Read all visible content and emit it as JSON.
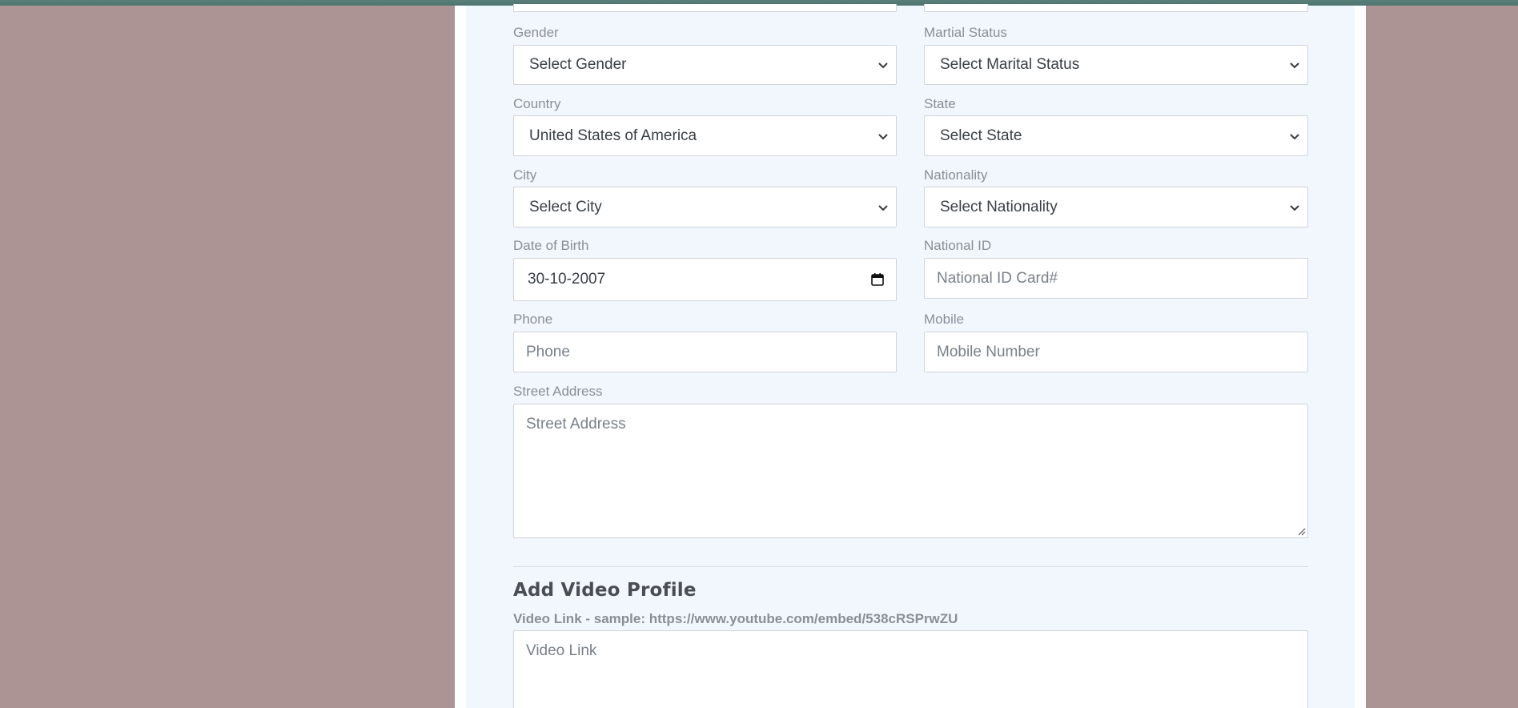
{
  "form": {
    "gender": {
      "label": "Gender",
      "value": "Select Gender"
    },
    "marital_status": {
      "label": "Martial Status",
      "value": "Select Marital Status"
    },
    "country": {
      "label": "Country",
      "value": "United States of America"
    },
    "state": {
      "label": "State",
      "value": "Select State"
    },
    "city": {
      "label": "City",
      "value": "Select City"
    },
    "nationality": {
      "label": "Nationality",
      "value": "Select Nationality"
    },
    "dob": {
      "label": "Date of Birth",
      "value": "30-10-2007"
    },
    "national_id": {
      "label": "National ID",
      "placeholder": "National ID Card#"
    },
    "phone": {
      "label": "Phone",
      "placeholder": "Phone"
    },
    "mobile": {
      "label": "Mobile",
      "placeholder": "Mobile Number"
    },
    "street_address": {
      "label": "Street Address",
      "placeholder": "Street Address"
    }
  },
  "video_section": {
    "title": "Add Video Profile",
    "hint": "Video Link - sample: https://www.youtube.com/embed/538cRSPrwZU",
    "placeholder": "Video Link"
  },
  "colors": {
    "page_bg": "#ac9495",
    "panel_bg": "#f2f6fd",
    "top_strip": "#5a7f7a"
  },
  "icons": {
    "select_arrow": "chevron-down-icon",
    "date_picker": "calendar-icon",
    "resize": "resize-grip-icon"
  }
}
